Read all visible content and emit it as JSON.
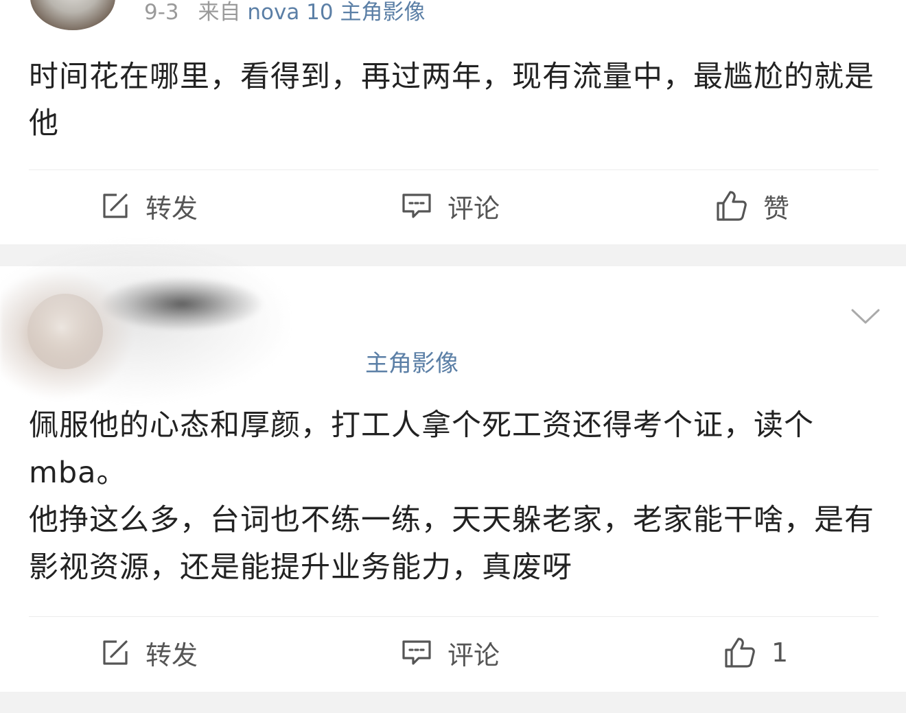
{
  "post1": {
    "date": "9-3",
    "source_prefix": "来自",
    "source_device": "nova 10 主角影像",
    "text": "时间花在哪里，看得到，再过两年，现有流量中，最尴尬的就是他",
    "actions": {
      "repost_label": "转发",
      "comment_label": "评论",
      "like_label": "赞"
    }
  },
  "post2": {
    "username_visible": "主角影像",
    "paragraphs": [
      "佩服他的心态和厚颜，打工人拿个死工资还得考个证，读个mba。",
      "他挣这么多，台词也不练一练，天天躲老家，老家能干啥，是有影视资源，还是能提升业务能力，真废呀"
    ],
    "actions": {
      "repost_label": "转发",
      "comment_label": "评论",
      "like_label": "1"
    }
  },
  "colors": {
    "link_blue": "#5b7fa6",
    "text": "#222222",
    "muted": "#9a9a9a",
    "separator": "#f2f2f2"
  },
  "icons": [
    "edit-share-icon",
    "comment-bubble-icon",
    "thumbs-up-icon",
    "chevron-down-icon"
  ]
}
